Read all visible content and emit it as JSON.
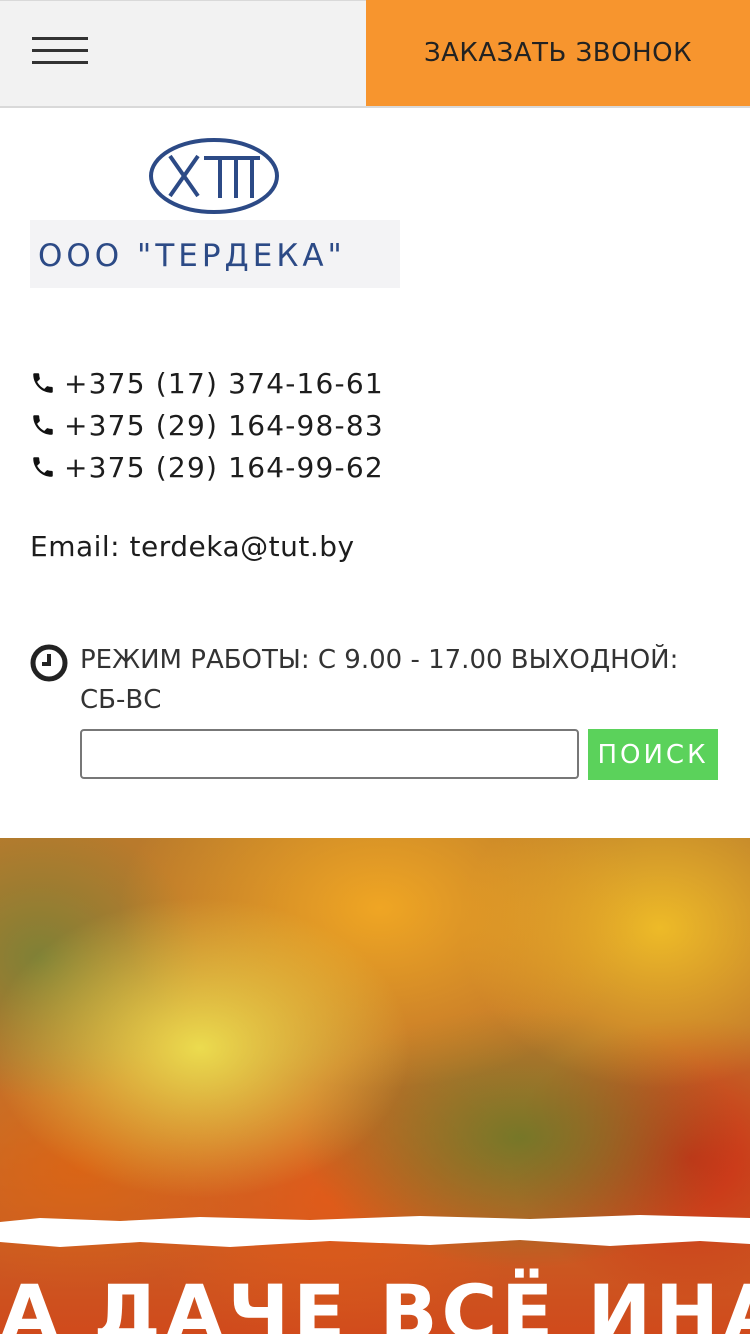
{
  "header": {
    "menu_icon": "hamburger-menu-icon",
    "call_button_label": "ЗАКАЗАТЬ ЗВОНОК",
    "accent_color": "#f7952e"
  },
  "logo": {
    "emblem_text": "XTII",
    "text": "ООО \"ТЕРДЕКА\""
  },
  "contacts": {
    "phone_icon": "phone-icon",
    "phones": [
      "+375 (17) 374-16-61",
      "+375 (29) 164-98-83",
      "+375 (29) 164-99-62"
    ],
    "email": "Email: terdeka@tut.by"
  },
  "hours": {
    "icon": "clock-icon",
    "text": "РЕЖИМ РАБОТЫ: С 9.00 - 17.00 ВЫХОДНОЙ: СБ-ВС"
  },
  "search": {
    "value": "",
    "button_label": "ПОИСК",
    "button_color": "#5bd25b"
  },
  "banner": {
    "text": "А ДАЧЕ ВСЁ ИНАЧЕ"
  }
}
